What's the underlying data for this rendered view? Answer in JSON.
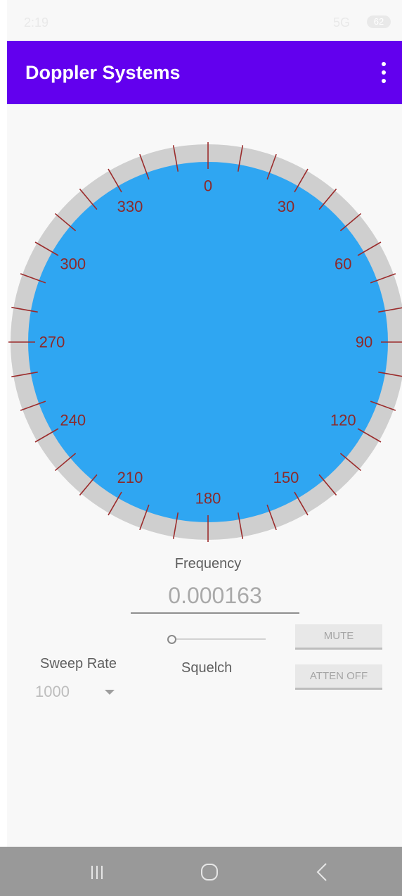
{
  "status_bar": {
    "time": "2:19",
    "network": "5G",
    "battery": "62"
  },
  "app_bar": {
    "title": "Doppler Systems",
    "menu_icon": "overflow-menu-icon"
  },
  "dial": {
    "bezel_color": "#cfcfcf",
    "face_color": "#2fa6f2",
    "tick_color": "#9b2c2c",
    "label_color": "#8b2a2a",
    "labels": [
      "0",
      "30",
      "60",
      "90",
      "120",
      "150",
      "180",
      "210",
      "240",
      "270",
      "300",
      "330"
    ]
  },
  "frequency": {
    "label": "Frequency",
    "value": "0.000163"
  },
  "squelch": {
    "label": "Squelch",
    "level": 0
  },
  "buttons": {
    "mute": "MUTE",
    "atten": "ATTEN OFF"
  },
  "sweep_rate": {
    "label": "Sweep Rate",
    "value": "1000"
  },
  "nav_bar": {
    "recent_icon": "recent-apps-icon",
    "home_icon": "home-icon",
    "back_icon": "back-icon"
  },
  "colors": {
    "app_bar": "#6200ee",
    "nav_bar": "#999999"
  }
}
